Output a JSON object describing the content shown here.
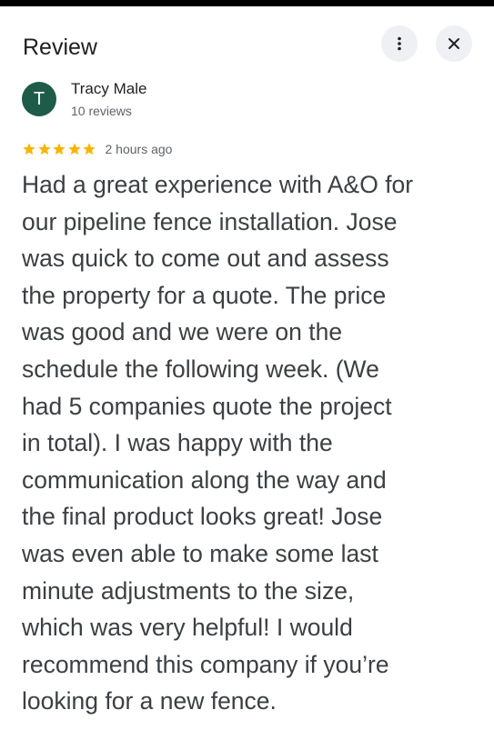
{
  "header": {
    "title": "Review"
  },
  "reviewer": {
    "initial": "T",
    "name": "Tracy Male",
    "review_count": "10 reviews"
  },
  "review": {
    "rating": 5,
    "time_ago": "2 hours ago",
    "text": "Had a great experience with A&O for\nour pipeline fence installation.  Jose\nwas quick to come out and assess\nthe property for a quote.  The price\nwas good and we were on the\nschedule the following week. (We\nhad 5 companies quote the project\nin total).  I was happy with the\ncommunication along the way and\nthe final product looks great! Jose\nwas even able to make some last\nminute adjustments to the size,\nwhich was very helpful!  I would\nrecommend this company if you’re\nlooking for a new fence."
  },
  "icons": {
    "more": "more-vert-icon",
    "close": "close-icon",
    "star": "star-icon"
  },
  "colors": {
    "avatar_bg": "#1e5b49",
    "star": "#f7b500",
    "button_bg": "#eef0f3"
  }
}
